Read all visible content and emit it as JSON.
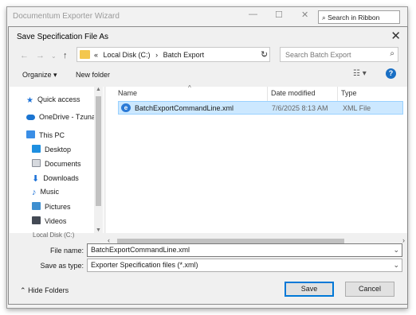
{
  "parent_window": {
    "title": "Documentum Exporter Wizard",
    "search_placeholder": "Search in Ribbon"
  },
  "dialog": {
    "title": "Save Specification File As",
    "address": {
      "crumbs": [
        "«",
        "Local Disk (C:)",
        "›",
        "Batch Export"
      ]
    },
    "search_placeholder": "Search Batch Export",
    "toolbar": {
      "organize": "Organize ▾",
      "new_folder": "New folder"
    },
    "nav": [
      {
        "label": "Quick access",
        "icon": "star-icon",
        "color": "#1e73d8"
      },
      {
        "label": "OneDrive - Tzunami",
        "icon": "cloud-icon",
        "color": "#1a74d1"
      },
      {
        "label": "This PC",
        "icon": "computer-icon",
        "color": "#3a8ee6"
      },
      {
        "label": "Desktop",
        "icon": "desktop-icon",
        "color": "#1e8fe0"
      },
      {
        "label": "Documents",
        "icon": "documents-icon",
        "color": "#8a8f98"
      },
      {
        "label": "Downloads",
        "icon": "downloads-icon",
        "color": "#1e73d8"
      },
      {
        "label": "Music",
        "icon": "music-icon",
        "color": "#1e73d8"
      },
      {
        "label": "Pictures",
        "icon": "pictures-icon",
        "color": "#3e8fd0"
      },
      {
        "label": "Videos",
        "icon": "videos-icon",
        "color": "#444a55"
      }
    ],
    "nav_partial": "Local Disk (C:)",
    "columns": {
      "name": "Name",
      "date": "Date modified",
      "type": "Type"
    },
    "files": [
      {
        "name": "BatchExportCommandLine.xml",
        "date": "7/6/2025 8:13 AM",
        "type": "XML File",
        "selected": true
      }
    ],
    "form": {
      "file_name_label": "File name:",
      "file_name_value": "BatchExportCommandLine.xml",
      "save_type_label": "Save as type:",
      "save_type_value": "Exporter Specification files (*.xml)"
    },
    "hide_folders": "Hide Folders",
    "save": "Save",
    "cancel": "Cancel"
  }
}
